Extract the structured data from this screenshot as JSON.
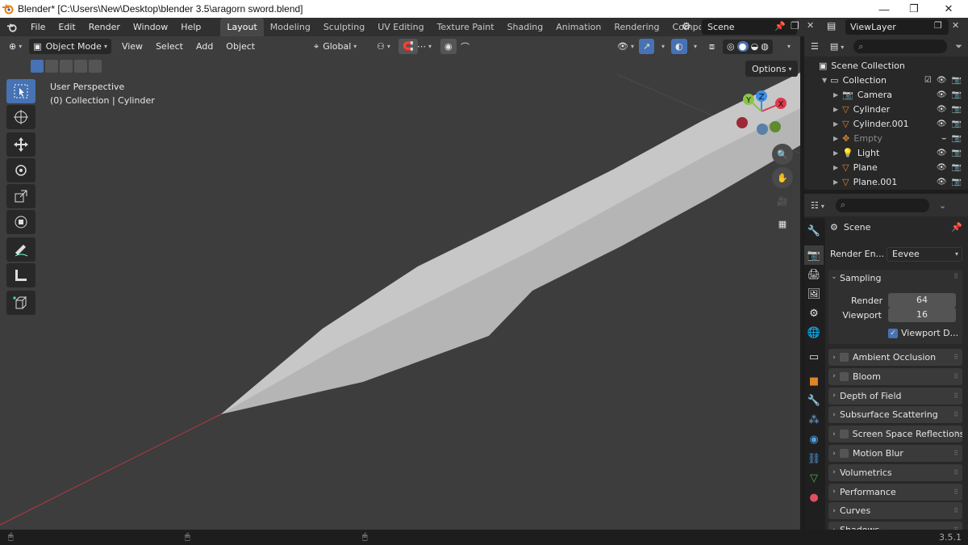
{
  "window": {
    "title": "Blender* [C:\\Users\\New\\Desktop\\blender 3.5\\aragorn sword.blend]",
    "minimize": "—",
    "maximize": "❐",
    "close": "✕"
  },
  "menu": [
    "File",
    "Edit",
    "Render",
    "Window",
    "Help"
  ],
  "workspace_tabs": [
    {
      "label": "Layout",
      "active": true
    },
    {
      "label": "Modeling"
    },
    {
      "label": "Sculpting"
    },
    {
      "label": "UV Editing"
    },
    {
      "label": "Texture Paint"
    },
    {
      "label": "Shading"
    },
    {
      "label": "Animation"
    },
    {
      "label": "Rendering"
    },
    {
      "label": "Compositin"
    }
  ],
  "scene_selector": "Scene",
  "view_layer": "ViewLayer",
  "viewport_header": {
    "mode": "Object Mode",
    "view": "View",
    "select": "Select",
    "add": "Add",
    "object": "Object",
    "transform_orientation": "Global",
    "options": "Options"
  },
  "viewport": {
    "perspective": "User Perspective",
    "collection_info": "(0) Collection | Cylinder",
    "gizmo": {
      "x": "X",
      "y": "Y",
      "z": "Z"
    }
  },
  "outliner": {
    "root": "Scene Collection",
    "collection": "Collection",
    "items": [
      {
        "name": "Camera",
        "icon": "camera-icon"
      },
      {
        "name": "Cylinder",
        "icon": "mesh-icon"
      },
      {
        "name": "Cylinder.001",
        "icon": "mesh-icon"
      },
      {
        "name": "Empty",
        "icon": "empty-icon",
        "dimmed": true
      },
      {
        "name": "Light",
        "icon": "light-icon"
      },
      {
        "name": "Plane",
        "icon": "mesh-icon"
      },
      {
        "name": "Plane.001",
        "icon": "mesh-icon"
      }
    ]
  },
  "properties": {
    "context": "Scene",
    "render_engine_label": "Render En...",
    "render_engine": "Eevee",
    "sampling": {
      "title": "Sampling",
      "render_label": "Render",
      "render_value": "64",
      "viewport_label": "Viewport",
      "viewport_value": "16",
      "denoise_label": "Viewport D..."
    },
    "panels": [
      {
        "label": "Ambient Occlusion",
        "checkbox": true
      },
      {
        "label": "Bloom",
        "checkbox": true
      },
      {
        "label": "Depth of Field",
        "checkbox": false
      },
      {
        "label": "Subsurface Scattering",
        "checkbox": false
      },
      {
        "label": "Screen Space Reflections",
        "checkbox": true
      },
      {
        "label": "Motion Blur",
        "checkbox": true
      },
      {
        "label": "Volumetrics",
        "checkbox": false
      },
      {
        "label": "Performance",
        "checkbox": false
      },
      {
        "label": "Curves",
        "checkbox": false
      },
      {
        "label": "Shadows",
        "checkbox": false
      }
    ]
  },
  "status": {
    "version": "3.5.1"
  },
  "colors": {
    "accent": "#4772b3",
    "axis_x": "#e0384c",
    "axis_y": "#8bc34a",
    "axis_z": "#3a8ee6",
    "mesh_orange": "#e0842a"
  }
}
